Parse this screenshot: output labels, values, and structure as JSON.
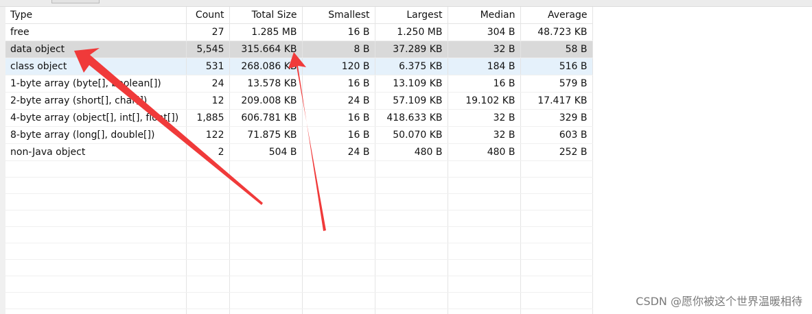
{
  "table": {
    "columns": [
      "Type",
      "Count",
      "Total Size",
      "Smallest",
      "Largest",
      "Median",
      "Average"
    ],
    "rows": [
      [
        "free",
        "27",
        "1.285 MB",
        "16 B",
        "1.250 MB",
        "304 B",
        "48.723 KB"
      ],
      [
        "data object",
        "5,545",
        "315.664 KB",
        "8 B",
        "37.289 KB",
        "32 B",
        "58 B"
      ],
      [
        "class object",
        "531",
        "268.086 KB",
        "120 B",
        "6.375 KB",
        "184 B",
        "516 B"
      ],
      [
        "1-byte array (byte[], boolean[])",
        "24",
        "13.578 KB",
        "16 B",
        "13.109 KB",
        "16 B",
        "579 B"
      ],
      [
        "2-byte array (short[], char[])",
        "12",
        "209.008 KB",
        "24 B",
        "57.109 KB",
        "19.102 KB",
        "17.417 KB"
      ],
      [
        "4-byte array (object[], int[], float[])",
        "1,885",
        "606.781 KB",
        "16 B",
        "418.633 KB",
        "32 B",
        "329 B"
      ],
      [
        "8-byte array (long[], double[])",
        "122",
        "71.875 KB",
        "16 B",
        "50.070 KB",
        "32 B",
        "603 B"
      ],
      [
        "non-Java object",
        "2",
        "504 B",
        "24 B",
        "480 B",
        "480 B",
        "252 B"
      ]
    ],
    "selected_row": 1,
    "hover_row": 2
  },
  "watermark": "CSDN @愿你被这个世界温暖相待",
  "colors": {
    "arrow": "#f03a3a",
    "selected_row": "#d9d9d9",
    "hover_row": "#e5f1fb"
  }
}
